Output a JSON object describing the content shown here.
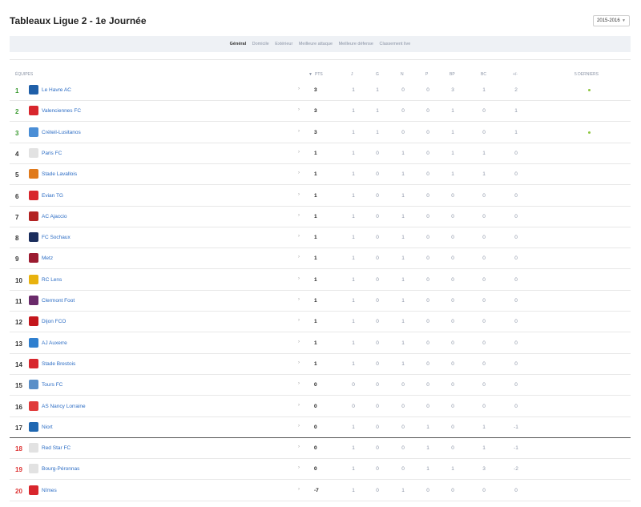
{
  "page": {
    "title": "Tableaux Ligue 2 - 1e Journée",
    "season": "2015-2016"
  },
  "tabs": [
    "Général",
    "Domicile",
    "Extérieur",
    "Meilleure attaque",
    "Meilleure défense",
    "Classement live"
  ],
  "headers": {
    "equipes": "ÉQUIPES",
    "pts": "PTS",
    "j": "J",
    "g": "G",
    "n": "N",
    "p": "P",
    "bp": "BP",
    "bc": "BC",
    "diff": "+/-",
    "last5": "5 DERNIERS"
  },
  "colors": {
    "green": "#3a9a30",
    "red": "#dd3333",
    "link": "#2b6cc4",
    "form_win": "#8dc63f"
  },
  "rows": [
    {
      "rank": "1",
      "team": "Le Havre AC",
      "pts": "3",
      "j": "1",
      "g": "1",
      "n": "0",
      "p": "0",
      "bp": "3",
      "bc": "1",
      "diff": "2",
      "form": "W",
      "logo_color": "#1f5fa8"
    },
    {
      "rank": "2",
      "team": "Valenciennes FC",
      "pts": "3",
      "j": "1",
      "g": "1",
      "n": "0",
      "p": "0",
      "bp": "1",
      "bc": "0",
      "diff": "1",
      "form": "",
      "logo_color": "#d8262d"
    },
    {
      "rank": "3",
      "team": "Créteil-Lusitanos",
      "pts": "3",
      "j": "1",
      "g": "1",
      "n": "0",
      "p": "0",
      "bp": "1",
      "bc": "0",
      "diff": "1",
      "form": "W",
      "logo_color": "#4a8ed6"
    },
    {
      "rank": "4",
      "team": "Paris FC",
      "pts": "1",
      "j": "1",
      "g": "0",
      "n": "1",
      "p": "0",
      "bp": "1",
      "bc": "1",
      "diff": "0",
      "form": "",
      "logo_color": "#e2e2e2"
    },
    {
      "rank": "5",
      "team": "Stade Lavallois",
      "pts": "1",
      "j": "1",
      "g": "0",
      "n": "1",
      "p": "0",
      "bp": "1",
      "bc": "1",
      "diff": "0",
      "form": "",
      "logo_color": "#e07a1c"
    },
    {
      "rank": "6",
      "team": "Evian TG",
      "pts": "1",
      "j": "1",
      "g": "0",
      "n": "1",
      "p": "0",
      "bp": "0",
      "bc": "0",
      "diff": "0",
      "form": "",
      "logo_color": "#d8262d"
    },
    {
      "rank": "7",
      "team": "AC Ajaccio",
      "pts": "1",
      "j": "1",
      "g": "0",
      "n": "1",
      "p": "0",
      "bp": "0",
      "bc": "0",
      "diff": "0",
      "form": "",
      "logo_color": "#b22222"
    },
    {
      "rank": "8",
      "team": "FC Sochaux",
      "pts": "1",
      "j": "1",
      "g": "0",
      "n": "1",
      "p": "0",
      "bp": "0",
      "bc": "0",
      "diff": "0",
      "form": "",
      "logo_color": "#1b2d5c"
    },
    {
      "rank": "9",
      "team": "Metz",
      "pts": "1",
      "j": "1",
      "g": "0",
      "n": "1",
      "p": "0",
      "bp": "0",
      "bc": "0",
      "diff": "0",
      "form": "",
      "logo_color": "#9b1b30"
    },
    {
      "rank": "10",
      "team": "RC Lens",
      "pts": "1",
      "j": "1",
      "g": "0",
      "n": "1",
      "p": "0",
      "bp": "0",
      "bc": "0",
      "diff": "0",
      "form": "",
      "logo_color": "#e8b20e"
    },
    {
      "rank": "11",
      "team": "Clermont Foot",
      "pts": "1",
      "j": "1",
      "g": "0",
      "n": "1",
      "p": "0",
      "bp": "0",
      "bc": "0",
      "diff": "0",
      "form": "",
      "logo_color": "#6a2a6a"
    },
    {
      "rank": "12",
      "team": "Dijon FCO",
      "pts": "1",
      "j": "1",
      "g": "0",
      "n": "1",
      "p": "0",
      "bp": "0",
      "bc": "0",
      "diff": "0",
      "form": "",
      "logo_color": "#c4161c"
    },
    {
      "rank": "13",
      "team": "AJ Auxerre",
      "pts": "1",
      "j": "1",
      "g": "0",
      "n": "1",
      "p": "0",
      "bp": "0",
      "bc": "0",
      "diff": "0",
      "form": "",
      "logo_color": "#2f7fcf"
    },
    {
      "rank": "14",
      "team": "Stade Brestois",
      "pts": "1",
      "j": "1",
      "g": "0",
      "n": "1",
      "p": "0",
      "bp": "0",
      "bc": "0",
      "diff": "0",
      "form": "",
      "logo_color": "#d8262d"
    },
    {
      "rank": "15",
      "team": "Tours FC",
      "pts": "0",
      "j": "0",
      "g": "0",
      "n": "0",
      "p": "0",
      "bp": "0",
      "bc": "0",
      "diff": "0",
      "form": "",
      "logo_color": "#5a8fc8"
    },
    {
      "rank": "16",
      "team": "AS Nancy Lorraine",
      "pts": "0",
      "j": "0",
      "g": "0",
      "n": "0",
      "p": "0",
      "bp": "0",
      "bc": "0",
      "diff": "0",
      "form": "",
      "logo_color": "#e03a3a"
    },
    {
      "rank": "17",
      "team": "Niort",
      "pts": "0",
      "j": "1",
      "g": "0",
      "n": "0",
      "p": "1",
      "bp": "0",
      "bc": "1",
      "diff": "-1",
      "form": "",
      "logo_color": "#1f67b1"
    },
    {
      "rank": "18",
      "team": "Red Star FC",
      "pts": "0",
      "j": "1",
      "g": "0",
      "n": "0",
      "p": "1",
      "bp": "0",
      "bc": "1",
      "diff": "-1",
      "form": "",
      "logo_color": "#e2e2e2"
    },
    {
      "rank": "19",
      "team": "Bourg-Péronnas",
      "pts": "0",
      "j": "1",
      "g": "0",
      "n": "0",
      "p": "1",
      "bp": "1",
      "bc": "3",
      "diff": "-2",
      "form": "",
      "logo_color": "#e2e2e2"
    },
    {
      "rank": "20",
      "team": "Nîmes",
      "pts": "-7",
      "j": "1",
      "g": "0",
      "n": "1",
      "p": "0",
      "bp": "0",
      "bc": "0",
      "diff": "0",
      "form": "",
      "logo_color": "#d8262d"
    }
  ]
}
